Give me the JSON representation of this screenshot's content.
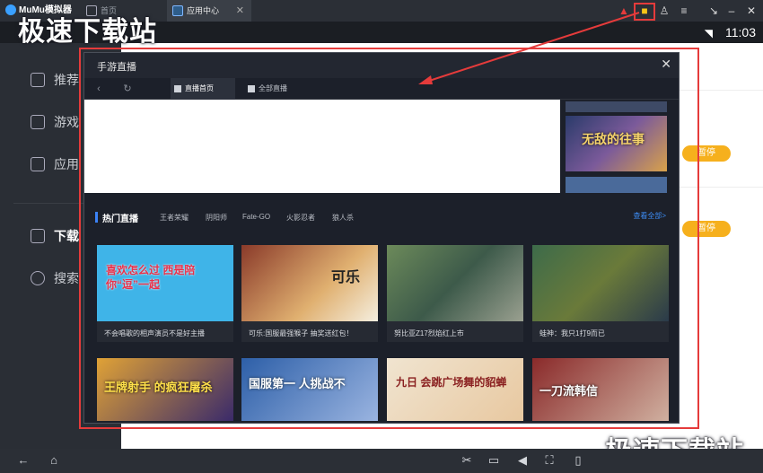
{
  "titlebar": {
    "app_name": "MuMu模拟器",
    "tabs": [
      {
        "label": "首页"
      },
      {
        "label": "应用中心"
      }
    ]
  },
  "statusbar": {
    "time": "11:03"
  },
  "sidebar": {
    "items": [
      {
        "label": "推荐"
      },
      {
        "label": "游戏"
      },
      {
        "label": "应用"
      },
      {
        "label": "下载"
      },
      {
        "label": "搜索"
      }
    ]
  },
  "content": {
    "pause_labels": [
      "暂停",
      "暂停"
    ]
  },
  "modal": {
    "title": "手游直播",
    "tabs": [
      {
        "label": "直播首页"
      },
      {
        "label": "全部直播"
      }
    ],
    "hot": {
      "title": "热门直播",
      "categories": [
        "王者荣耀",
        "阴阳师",
        "Fate-GO",
        "火影忍者",
        "狼人杀"
      ],
      "more": "查看全部>"
    },
    "cards": [
      {
        "caption": "不会唱歌的相声演员不是好主播",
        "color": "#3fb4e8",
        "text": "喜欢怎么过 西是陪你“逗”一起"
      },
      {
        "caption": "可乐:国服最强猴子 抽奖送红包！",
        "color": "#c9824a",
        "text": "可乐"
      },
      {
        "caption": "努比亚Z17烈焰红上市",
        "color": "#4c7d5a",
        "text": ""
      },
      {
        "caption": "蛙神：我只1打9而已",
        "color": "#3d6b4a",
        "text": ""
      }
    ],
    "cards2": [
      {
        "color": "#e0a236",
        "text": "王牌射手 的疯狂屠杀"
      },
      {
        "color": "#2d5fa8",
        "text": "国服第一 人挑战不"
      },
      {
        "color": "#f0e4d0",
        "text": "九日 会跳广场舞的貂蝉"
      },
      {
        "color": "#8a2a2a",
        "text": "一刀流韩信"
      }
    ],
    "thumb_text": "无敌的往事"
  },
  "watermark": {
    "top_left": "极速下载站",
    "bottom_right": "极速下载站"
  }
}
